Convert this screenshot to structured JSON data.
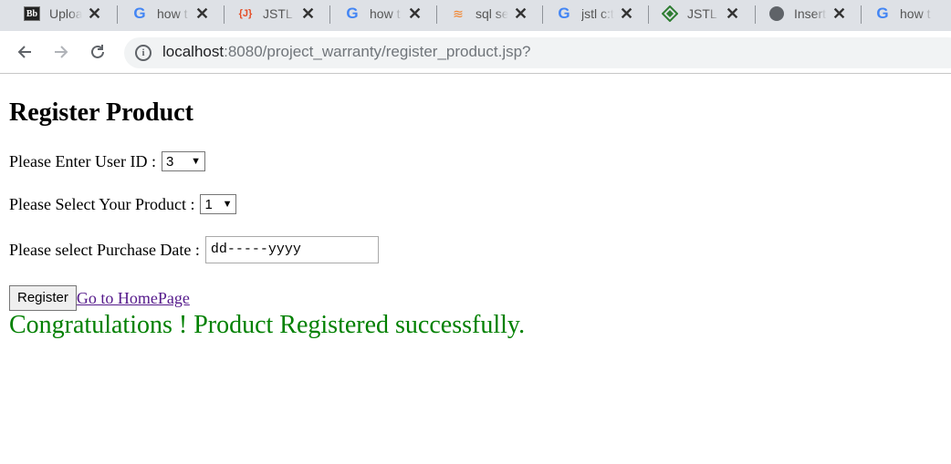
{
  "browser": {
    "tabs": [
      {
        "title": "Uploa",
        "icon": "blackboard-icon"
      },
      {
        "title": "how t",
        "icon": "google-icon"
      },
      {
        "title": "JSTL S",
        "icon": "jstl-icon"
      },
      {
        "title": "how t",
        "icon": "google-icon"
      },
      {
        "title": "sql se",
        "icon": "stackoverflow-icon"
      },
      {
        "title": "jstl c:t",
        "icon": "google-icon"
      },
      {
        "title": "JSTL -",
        "icon": "jstl-icon"
      },
      {
        "title": "Insert",
        "icon": "globe-icon"
      },
      {
        "title": "how t",
        "icon": "google-icon"
      }
    ],
    "favicon_text": {
      "bb": "Bb",
      "g": "G",
      "j": "{J}"
    },
    "close_glyph": "✕",
    "url_host": "localhost",
    "url_rest": ":8080/project_warranty/register_product.jsp?"
  },
  "page": {
    "heading": "Register Product",
    "user_id_label": "Please Enter User ID :",
    "user_id_value": "3",
    "product_label": "Please Select Your Product :",
    "product_value": "1",
    "date_label": "Please select Purchase Date :",
    "date_placeholder": "dd-----yyyy",
    "register_button": "Register",
    "homepage_link": " Go to HomePage",
    "success_message": "Congratulations ! Product Registered successfully."
  },
  "colors": {
    "success": "#008000",
    "link": "#551a8b"
  }
}
